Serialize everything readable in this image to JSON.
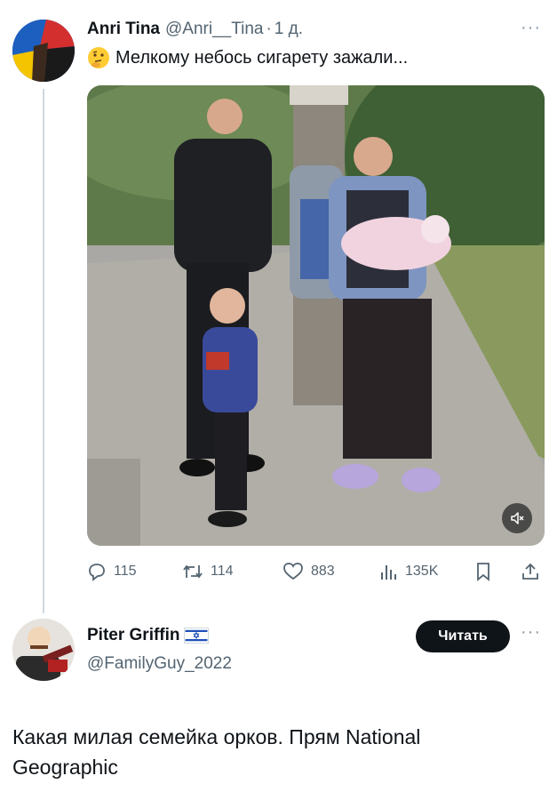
{
  "tweet1": {
    "name": "Anri Tina",
    "handle": "@Anri__Tina",
    "separator": "·",
    "time": "1 д.",
    "emoji": "thinking-face-icon",
    "text": "Мелкому небось сигарету зажали...",
    "media": {
      "type": "photo",
      "icon": "mute-icon"
    },
    "actions": {
      "replies": "115",
      "retweets": "114",
      "likes": "883",
      "views": "135K"
    }
  },
  "tweet2": {
    "name": "Piter Griffin",
    "handle": "@FamilyGuy_2022",
    "follow_label": "Читать",
    "text": "Какая милая семейка орков. Прям National Geographic"
  },
  "colors": {
    "text": "#0f1419",
    "secondary": "#536471",
    "thread_line": "#cfd9de",
    "button_bg": "#0f1419"
  }
}
